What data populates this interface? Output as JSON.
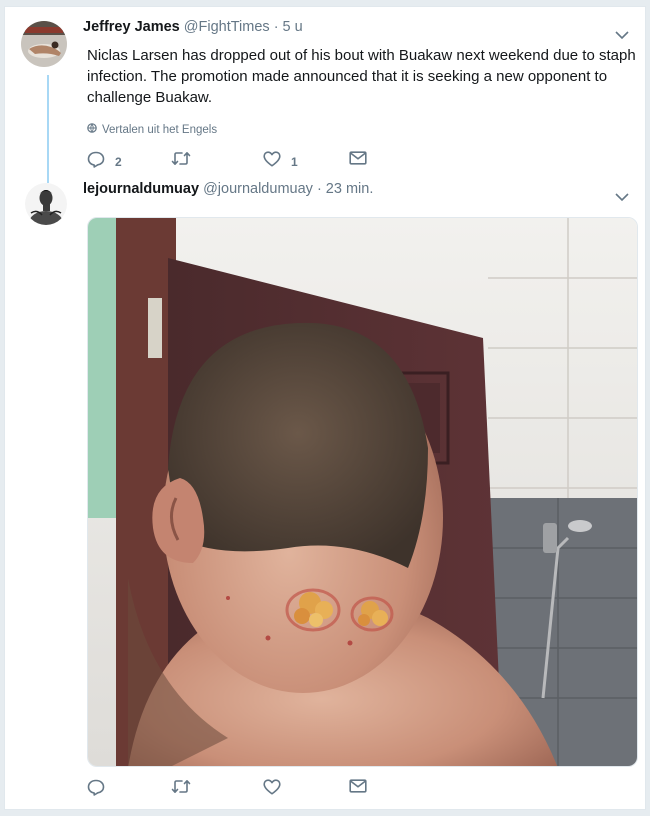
{
  "tweet1": {
    "name": "Jeffrey James",
    "handle": "@FightTimes",
    "time": "· 5 u",
    "text": "Niclas Larsen has dropped out of his bout with Buakaw next weekend due to staph infection. The promotion made announced that it is seeking a new opponent to challenge Buakaw.",
    "translate_label": "Vertalen uit het Engels",
    "reply_count": "2",
    "like_count": "1"
  },
  "tweet2": {
    "name": "lejournaldumuay",
    "handle": "@journaldumuay",
    "time": "· 23 min."
  },
  "colors": {
    "thread_line": "#a8d8f5",
    "icon": "#657786",
    "handle": "#657786"
  }
}
